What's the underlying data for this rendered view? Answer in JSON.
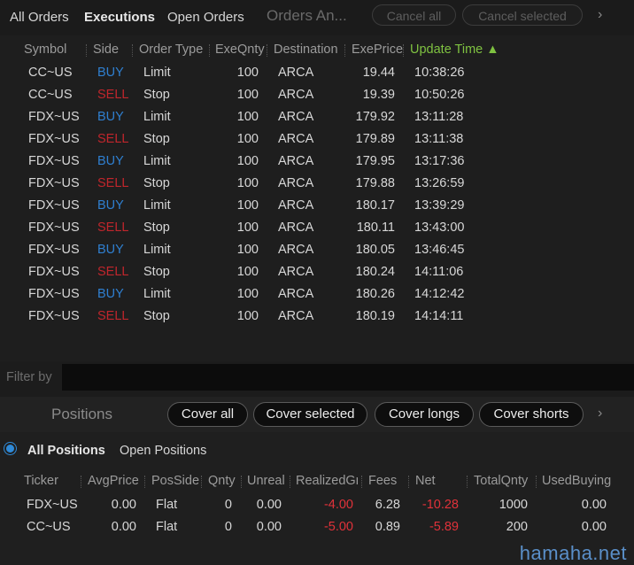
{
  "top_tabs": {
    "all_orders": "All Orders",
    "executions": "Executions",
    "open_orders": "Open Orders",
    "orders_analysis": "Orders An...",
    "cancel_all": "Cancel all",
    "cancel_selected": "Cancel selected",
    "more": "›"
  },
  "orders": {
    "columns": {
      "symbol": "Symbol",
      "side": "Side",
      "order_type": "Order Type",
      "exe_qnty": "ExeQnty",
      "destination": "Destination",
      "exe_price": "ExePrice",
      "update_time": "Update Time ▲"
    },
    "rows": [
      {
        "symbol": "CC~US",
        "side": "BUY",
        "type": "Limit",
        "qty": "100",
        "dest": "ARCA",
        "price": "19.44",
        "time": "10:38:26"
      },
      {
        "symbol": "CC~US",
        "side": "SELL",
        "type": "Stop",
        "qty": "100",
        "dest": "ARCA",
        "price": "19.39",
        "time": "10:50:26"
      },
      {
        "symbol": "FDX~US",
        "side": "BUY",
        "type": "Limit",
        "qty": "100",
        "dest": "ARCA",
        "price": "179.92",
        "time": "13:11:28"
      },
      {
        "symbol": "FDX~US",
        "side": "SELL",
        "type": "Stop",
        "qty": "100",
        "dest": "ARCA",
        "price": "179.89",
        "time": "13:11:38"
      },
      {
        "symbol": "FDX~US",
        "side": "BUY",
        "type": "Limit",
        "qty": "100",
        "dest": "ARCA",
        "price": "179.95",
        "time": "13:17:36"
      },
      {
        "symbol": "FDX~US",
        "side": "SELL",
        "type": "Stop",
        "qty": "100",
        "dest": "ARCA",
        "price": "179.88",
        "time": "13:26:59"
      },
      {
        "symbol": "FDX~US",
        "side": "BUY",
        "type": "Limit",
        "qty": "100",
        "dest": "ARCA",
        "price": "180.17",
        "time": "13:39:29"
      },
      {
        "symbol": "FDX~US",
        "side": "SELL",
        "type": "Stop",
        "qty": "100",
        "dest": "ARCA",
        "price": "180.11",
        "time": "13:43:00"
      },
      {
        "symbol": "FDX~US",
        "side": "BUY",
        "type": "Limit",
        "qty": "100",
        "dest": "ARCA",
        "price": "180.05",
        "time": "13:46:45"
      },
      {
        "symbol": "FDX~US",
        "side": "SELL",
        "type": "Stop",
        "qty": "100",
        "dest": "ARCA",
        "price": "180.24",
        "time": "14:11:06"
      },
      {
        "symbol": "FDX~US",
        "side": "BUY",
        "type": "Limit",
        "qty": "100",
        "dest": "ARCA",
        "price": "180.26",
        "time": "14:12:42"
      },
      {
        "symbol": "FDX~US",
        "side": "SELL",
        "type": "Stop",
        "qty": "100",
        "dest": "ARCA",
        "price": "180.19",
        "time": "14:14:11"
      }
    ]
  },
  "filter": {
    "label": "Filter by",
    "value": ""
  },
  "positions_bar": {
    "title": "Positions",
    "cover_all": "Cover all",
    "cover_selected": "Cover selected",
    "cover_longs": "Cover longs",
    "cover_shorts": "Cover shorts",
    "more": "›"
  },
  "positions": {
    "tab_all": "All Positions",
    "tab_open": "Open Positions",
    "columns": {
      "ticker": "Ticker",
      "avg_price": "AvgPrice",
      "pos_side": "PosSide",
      "qnty": "Qnty",
      "unreal": "Unreal",
      "realized": "RealizedGr",
      "fees": "Fees",
      "net": "Net",
      "total_qnty": "TotalQnty",
      "used_buying": "UsedBuying"
    },
    "rows": [
      {
        "ticker": "FDX~US",
        "avg_price": "0.00",
        "pos_side": "Flat",
        "qnty": "0",
        "unreal": "0.00",
        "realized": "-4.00",
        "fees": "6.28",
        "net": "-10.28",
        "total_qnty": "1000",
        "used_buying": "0.00"
      },
      {
        "ticker": "CC~US",
        "avg_price": "0.00",
        "pos_side": "Flat",
        "qnty": "0",
        "unreal": "0.00",
        "realized": "-5.00",
        "fees": "0.89",
        "net": "-5.89",
        "total_qnty": "200",
        "used_buying": "0.00"
      }
    ]
  },
  "watermark": "hamaha.net",
  "colors": {
    "buy": "#2f7fd0",
    "sell": "#c0262c",
    "negative": "#e0323a",
    "sorted_header": "#7fc241"
  }
}
